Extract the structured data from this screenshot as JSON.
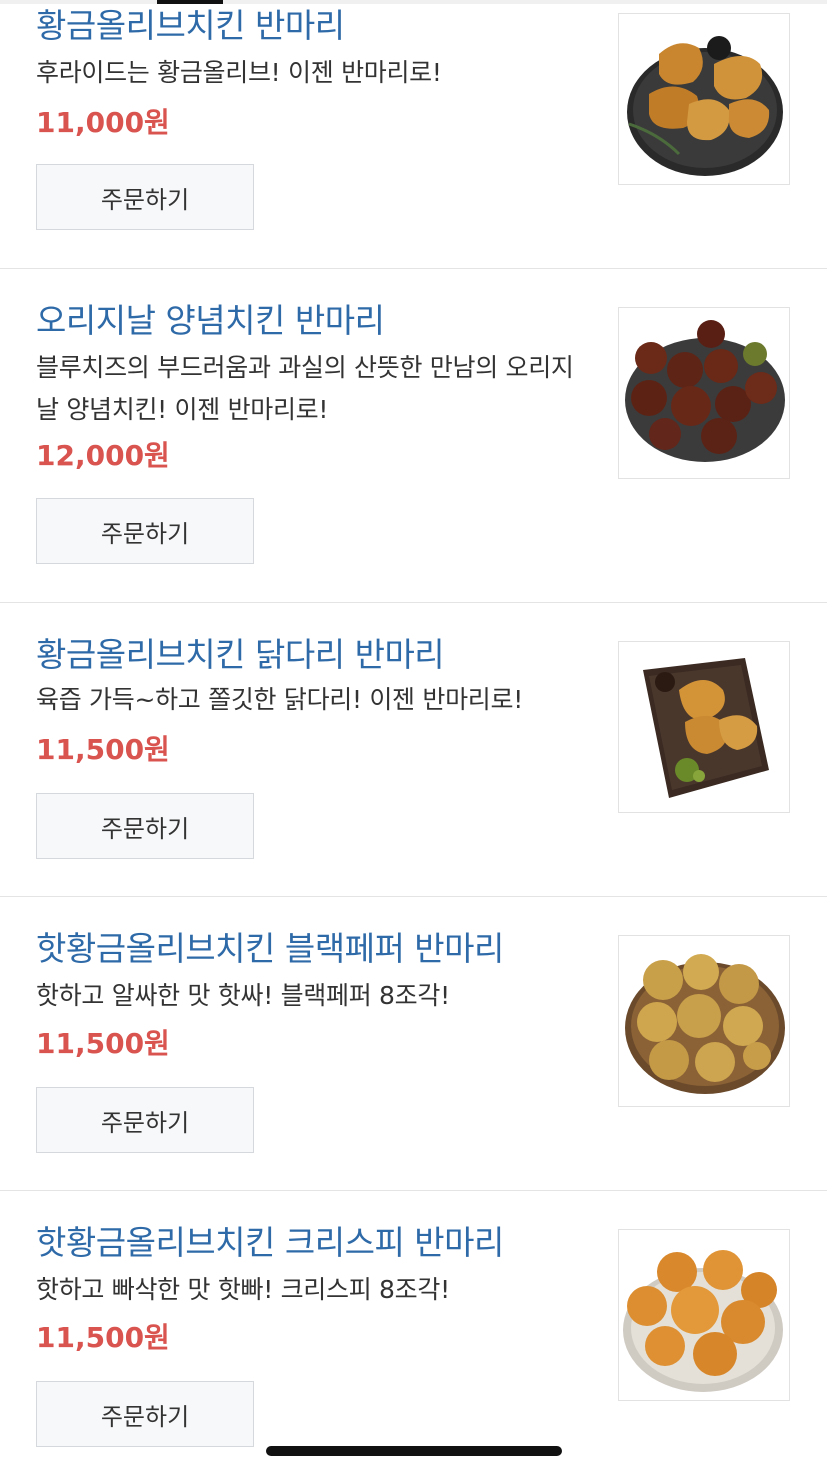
{
  "menu": {
    "order_label": "주문하기",
    "items": [
      {
        "name": "황금올리브치킨 반마리",
        "desc": "후라이드는 황금올리브! 이젠 반마리로!",
        "price": "11,000원",
        "image": "fried-chicken-plate-photo"
      },
      {
        "name": "오리지날 양념치킨 반마리",
        "desc": "블루치즈의 부드러움과 과실의 산뜻한 만남의 오리지날 양념치킨! 이젠 반마리로!",
        "price": "12,000원",
        "image": "seasoned-chicken-plate-photo"
      },
      {
        "name": "황금올리브치킨 닭다리 반마리",
        "desc": "육즙 가득~하고 쫄깃한 닭다리! 이젠 반마리로!",
        "price": "11,500원",
        "image": "chicken-drumstick-tray-photo"
      },
      {
        "name": "핫황금올리브치킨 블랙페퍼 반마리",
        "desc": "핫하고 알싸한 맛 핫싸! 블랙페퍼 8조각!",
        "price": "11,500원",
        "image": "black-pepper-chicken-plate-photo"
      },
      {
        "name": "핫황금올리브치킨 크리스피 반마리",
        "desc": "핫하고 빠삭한 맛 핫빠! 크리스피 8조각!",
        "price": "11,500원",
        "image": "crispy-chicken-plate-photo"
      }
    ]
  },
  "colors": {
    "name": "#2f6aa8",
    "price": "#d9534f",
    "button_bg": "#f7f8fa"
  }
}
